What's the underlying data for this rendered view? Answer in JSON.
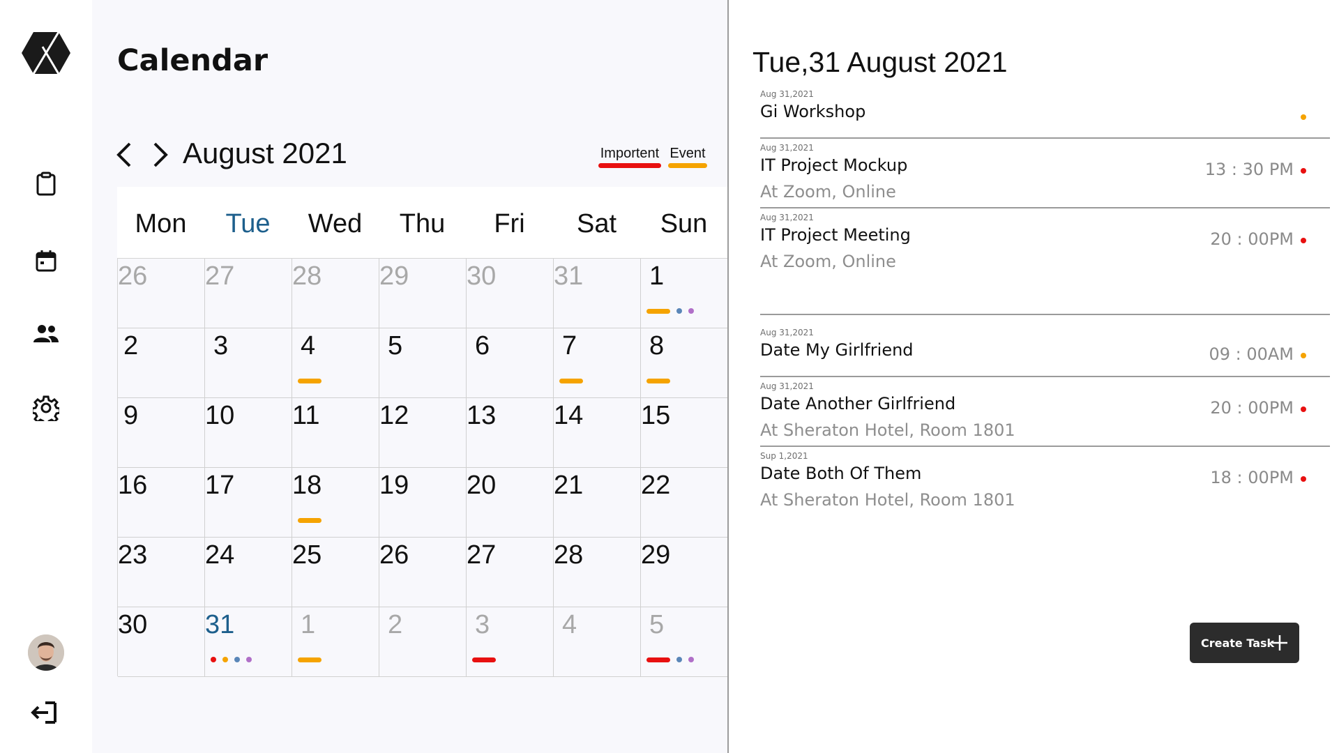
{
  "app": {
    "title": "Calendar"
  },
  "sidebar": {
    "logo": "hexagon-x-logo",
    "items": [
      {
        "icon": "clipboard-icon"
      },
      {
        "icon": "calendar-icon"
      },
      {
        "icon": "people-icon"
      },
      {
        "icon": "gear-icon"
      }
    ],
    "avatar": "user-avatar",
    "logout_icon": "logout-icon"
  },
  "calendar": {
    "month_label": "August 2021",
    "legend": {
      "important_label": "Importent",
      "event_label": "Event",
      "important_color": "#e81010",
      "event_color": "#f5a300"
    },
    "weekdays": [
      "Mon",
      "Tue",
      "Wed",
      "Thu",
      "Fri",
      "Sat",
      "Sun"
    ],
    "active_weekday": "Tue",
    "weeks": [
      [
        {
          "day": "26",
          "muted": true
        },
        {
          "day": "27",
          "muted": true
        },
        {
          "day": "28",
          "muted": true
        },
        {
          "day": "29",
          "muted": true
        },
        {
          "day": "30",
          "muted": true
        },
        {
          "day": "31",
          "muted": true
        },
        {
          "day": "1",
          "muted": false,
          "marks": [
            "event",
            "dot:#5a86b8",
            "dot:#b06fc8"
          ]
        }
      ],
      [
        {
          "day": "2"
        },
        {
          "day": "3"
        },
        {
          "day": "4",
          "marks": [
            "event"
          ]
        },
        {
          "day": "5"
        },
        {
          "day": "6"
        },
        {
          "day": "7",
          "marks": [
            "event"
          ]
        },
        {
          "day": "8",
          "marks": [
            "event"
          ]
        }
      ],
      [
        {
          "day": "9"
        },
        {
          "day": "10"
        },
        {
          "day": "11"
        },
        {
          "day": "12"
        },
        {
          "day": "13"
        },
        {
          "day": "14"
        },
        {
          "day": "15"
        }
      ],
      [
        {
          "day": "16"
        },
        {
          "day": "17"
        },
        {
          "day": "18",
          "marks": [
            "event"
          ]
        },
        {
          "day": "19"
        },
        {
          "day": "20"
        },
        {
          "day": "21"
        },
        {
          "day": "22"
        }
      ],
      [
        {
          "day": "23"
        },
        {
          "day": "24"
        },
        {
          "day": "25"
        },
        {
          "day": "26"
        },
        {
          "day": "27"
        },
        {
          "day": "28"
        },
        {
          "day": "29"
        }
      ],
      [
        {
          "day": "30"
        },
        {
          "day": "31",
          "today": true,
          "marks": [
            "dot:#e81010",
            "dot:#f5a300",
            "dot:#5a86b8",
            "dot:#b06fc8"
          ]
        },
        {
          "day": "1",
          "muted": true,
          "marks": [
            "event"
          ]
        },
        {
          "day": "2",
          "muted": true
        },
        {
          "day": "3",
          "muted": true,
          "marks": [
            "important"
          ]
        },
        {
          "day": "4",
          "muted": true
        },
        {
          "day": "5",
          "muted": true,
          "marks": [
            "important",
            "dot:#5a86b8",
            "dot:#b06fc8"
          ]
        }
      ]
    ]
  },
  "details": {
    "title": "Tue,31 August 2021",
    "events": [
      {
        "date": "Aug 31,2021",
        "name": "Gi Workshop",
        "time": "",
        "location": "",
        "dot": "#f5a300"
      },
      {
        "date": "Aug 31,2021",
        "name": "IT Project Mockup",
        "time": "13 : 30 PM",
        "location": "At Zoom, Online",
        "dot": "#e81010"
      },
      {
        "date": "Aug 31,2021",
        "name": "IT Project Meeting",
        "time": "20 : 00PM",
        "location": "At Zoom, Online",
        "dot": "#e81010"
      },
      {
        "date": "Aug 31,2021",
        "name": "Date My Girlfriend",
        "time": "09 : 00AM",
        "location": "",
        "dot": "#f5a300"
      },
      {
        "date": "Aug 31,2021",
        "name": "Date Another Girlfriend",
        "time": "20 : 00PM",
        "location": "At Sheraton Hotel,  Room 1801",
        "dot": "#e81010"
      },
      {
        "date": "Sup 1,2021",
        "name": "Date Both Of Them",
        "time": "18 : 00PM",
        "location": "At Sheraton Hotel,  Room 1801",
        "dot": "#e81010"
      }
    ],
    "create_button_label": "Create Task"
  }
}
